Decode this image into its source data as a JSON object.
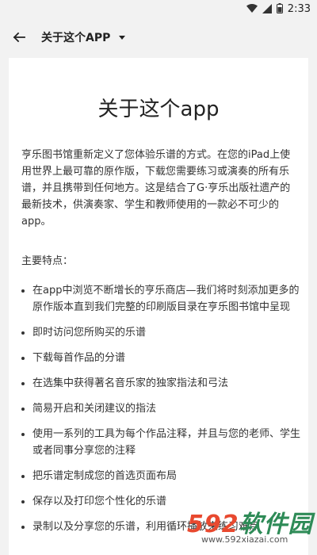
{
  "status_bar": {
    "time": "2:33",
    "icons": [
      "wifi-icon",
      "signal-icon",
      "battery-icon"
    ]
  },
  "app_bar": {
    "title": "关于这个APP",
    "back_icon": "arrow-left-icon",
    "dropdown_icon": "caret-down-icon"
  },
  "content": {
    "title": "关于这个app",
    "intro": "亨乐图书馆重新定义了您体验乐谱的方式。在您的iPad上使用世界上最可靠的原作版，下载您需要练习或演奏的所有乐谱，并且携带到任何地方。这是结合了G·亨乐出版社遗产的最新技术，供演奏家、学生和教师使用的一款必不可少的app。",
    "features_title": "主要特点：",
    "features": [
      "在app中浏览不断增长的亨乐商店—我们将时刻添加更多的原作版本直到我们完整的印刷版目录在亨乐图书馆中呈现",
      "即时访问您所购买的乐谱",
      "下载每首作品的分谱",
      "在选集中获得著名音乐家的独家指法和弓法",
      "简易开启和关闭建议的指法",
      "使用一系列的工具为每个作品注释，并且与您的老师、学生或者同事分享您的注释",
      "把乐谱定制成您的首选页面布局",
      "保存以及打印您个性化的乐谱",
      "录制以及分享您的乐谱，利用循环播放来练习难点"
    ]
  },
  "watermark": {
    "logo_number": "592",
    "logo_text": "软件园",
    "url": "www.592xiazai.com"
  }
}
